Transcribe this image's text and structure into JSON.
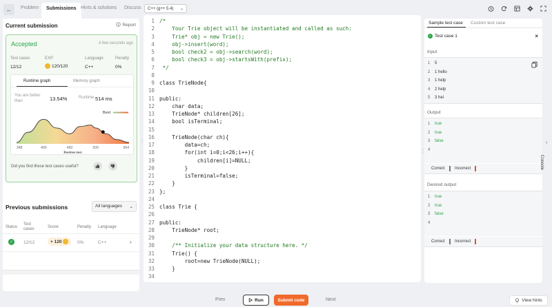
{
  "tabs": [
    {
      "label": "Problem"
    },
    {
      "label": "Submissions"
    },
    {
      "label": "Hints & solutions"
    },
    {
      "label": "Discuss"
    }
  ],
  "language_select": "C++ (g++ 5.4)",
  "current_submission": {
    "title": "Current submission",
    "report_label": "Report",
    "status": "Accepted",
    "time": "A few seconds ago",
    "stats": {
      "test_cases_label": "Test cases",
      "test_cases_value": "12/12",
      "exp_label": "EXP",
      "exp_value": "120/120",
      "language_label": "Language",
      "language_value": "C++",
      "penalty_label": "Penalty",
      "penalty_value": "0%"
    },
    "graph_tabs": {
      "runtime": "Runtime graph",
      "memory": "Memory graph"
    },
    "better_label": "You are better than",
    "better_value": "13.54%",
    "runtime_label": "Runtime",
    "runtime_value": "514 ms",
    "best_label": "Best",
    "feedback_question": "Did you find these test cases useful?"
  },
  "chart_data": {
    "type": "area",
    "x": [
      348,
      370,
      400,
      425,
      450,
      470,
      490,
      500,
      520,
      540,
      564
    ],
    "y": [
      5,
      40,
      85,
      55,
      35,
      60,
      65,
      55,
      35,
      15,
      5
    ],
    "x_ticks": [
      "348",
      "400",
      "450",
      "500",
      "564"
    ],
    "xlabel": "Runtime (ms)",
    "marker_x": 514
  },
  "previous_submissions": {
    "title": "Previous submissions",
    "filter_label": "All languages",
    "headers": {
      "status": "Status",
      "test_cases": "Test\ncases",
      "score": "Score",
      "penalty": "Penalty",
      "language": "Language"
    },
    "rows": [
      {
        "test_cases": "12/12",
        "score": "+ 120",
        "penalty": "0%",
        "language": "C++"
      }
    ]
  },
  "code_lines": [
    "/*",
    "    Your Trie object will be instantiated and called as such:",
    "    Trie* obj = new Trie();",
    "    obj->insert(word);",
    "    bool check2 = obj->search(word);",
    "    bool check3 = obj->startsWith(prefix);",
    " */",
    "",
    "class TrieNode{",
    "",
    "public:",
    "    char data;",
    "    TrieNode* children[26];",
    "    bool isTerminal;",
    "",
    "    TrieNode(char ch){",
    "        data=ch;",
    "        for(int i=0;i<26;i++){",
    "            children[i]=NULL;",
    "        }",
    "        isTerminal=false;",
    "    }",
    "};",
    "",
    "class Trie {",
    "",
    "public:",
    "    TrieNode* root;",
    "",
    "    /** Initialize your data structure here. */",
    "    Trie() {",
    "        root=new TrieNode(NULL);",
    "    }",
    ""
  ],
  "right_panel": {
    "tabs": {
      "sample": "Sample test case",
      "custom": "Custom test case"
    },
    "test_case_label": "Test case 1",
    "input_label": "Input",
    "input_lines": [
      "5",
      "1 hello",
      "1 help",
      "2 help",
      "3 hel"
    ],
    "output_label": "Output",
    "output_lines": [
      "true",
      "true",
      "false",
      ""
    ],
    "correct_label": "Correct",
    "incorrect_label": "Incorrect",
    "desired_label": "Desired output",
    "desired_lines": [
      "true",
      "true",
      "false",
      ""
    ],
    "console_label": "Console"
  },
  "bottom": {
    "prev": "Prev",
    "run": "Run",
    "submit": "Submit code",
    "next": "Next",
    "hints": "View hints"
  },
  "colors": {
    "accent": "#f06a2b",
    "success": "#2aa44a",
    "error": "#e74c3c"
  }
}
